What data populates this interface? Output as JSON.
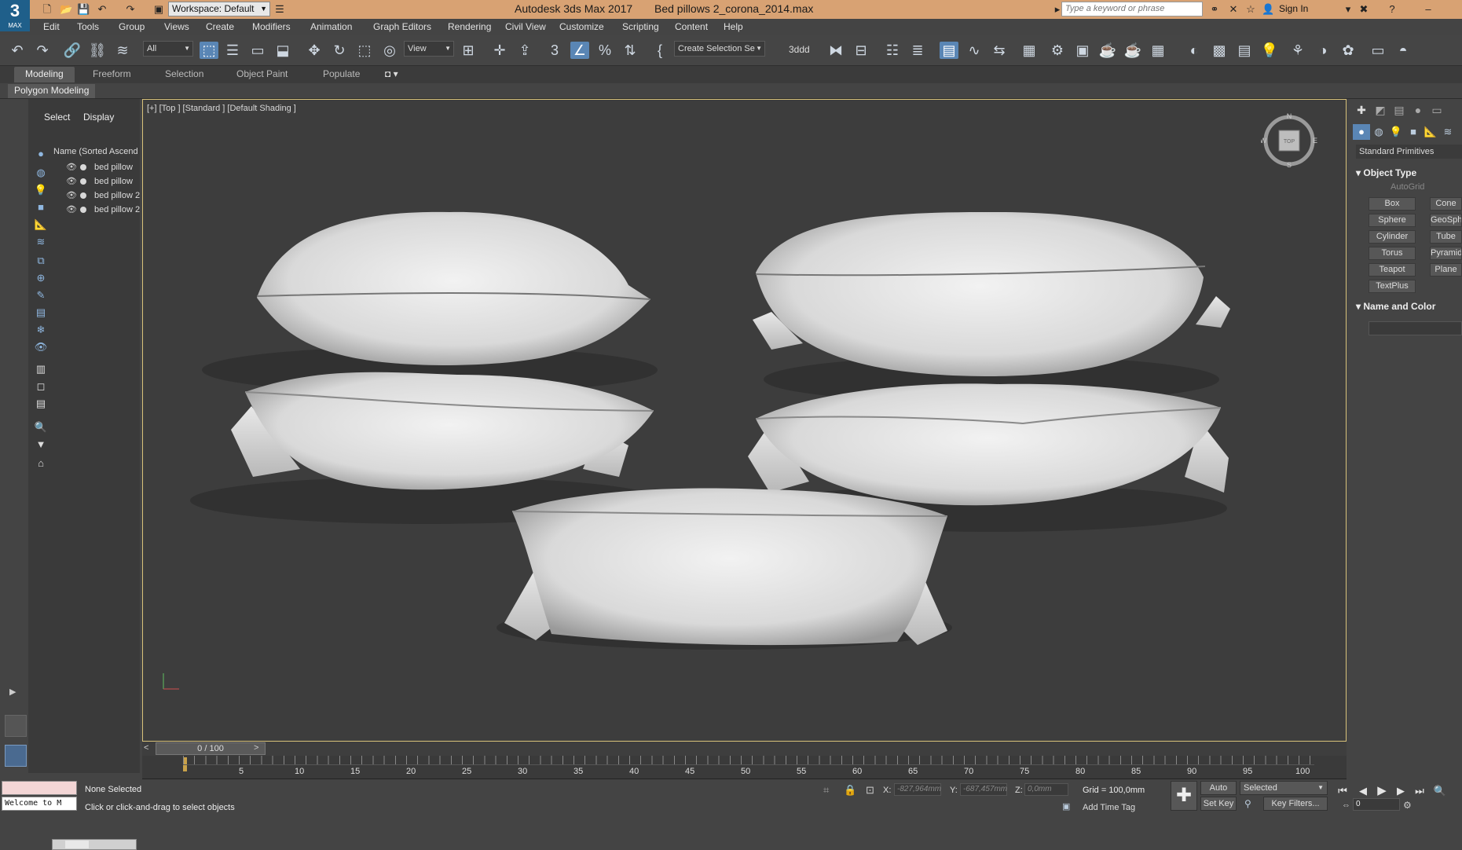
{
  "app": {
    "logo_text": "3",
    "logo_sub": "MAX",
    "title": "Autodesk 3ds Max 2017",
    "file": "Bed pillows 2_corona_2014.max",
    "workspace": "Workspace: Default",
    "search_placeholder": "Type a keyword or phrase",
    "sign_in": "Sign In"
  },
  "menu": [
    "Edit",
    "Tools",
    "Group",
    "Views",
    "Create",
    "Modifiers",
    "Animation",
    "Graph Editors",
    "Rendering",
    "Civil View",
    "Customize",
    "Scripting",
    "Content",
    "Help"
  ],
  "toolbar": {
    "filter": "All",
    "ref_coord": "View",
    "selection_set": "Create Selection Se",
    "label_3ddd": "3ddd"
  },
  "ribbon": {
    "tabs": [
      "Modeling",
      "Freeform",
      "Selection",
      "Object Paint",
      "Populate"
    ],
    "active_tab": "Modeling",
    "panel": "Polygon Modeling"
  },
  "explorer": {
    "tabs": [
      "Select",
      "Display"
    ],
    "header": "Name (Sorted Ascend",
    "rows": [
      "bed pillow",
      "bed pillow",
      "bed pillow 2",
      "bed pillow 2"
    ]
  },
  "viewport": {
    "label": "[+] [Top ] [Standard ] [Default Shading ]",
    "compass": {
      "n": "N",
      "s": "S",
      "e": "E",
      "w": "W",
      "face": "TOP"
    }
  },
  "command_panel": {
    "category": "Standard Primitives",
    "object_type_title": "Object Type",
    "autogrid": "AutoGrid",
    "buttons_left": [
      "Box",
      "Sphere",
      "Cylinder",
      "Torus",
      "Teapot",
      "TextPlus"
    ],
    "buttons_right": [
      "Cone",
      "GeoSphere",
      "Tube",
      "Pyramid",
      "Plane"
    ],
    "name_color_title": "Name and Color"
  },
  "timeline": {
    "position": "0 / 100",
    "ticks": [
      "5",
      "10",
      "15",
      "20",
      "25",
      "30",
      "35",
      "40",
      "45",
      "50",
      "55",
      "60",
      "65",
      "70",
      "75",
      "80",
      "85",
      "90",
      "95",
      "100"
    ]
  },
  "status": {
    "maxscript_text": "Welcome to M",
    "selection": "None Selected",
    "prompt": "Click or click-and-drag to select objects",
    "x_label": "X:",
    "x_value": "-827,964mm",
    "y_label": "Y:",
    "y_value": "-687,457mm",
    "z_label": "Z:",
    "z_value": "0,0mm",
    "grid": "Grid = 100,0mm",
    "add_time_tag": "Add Time Tag",
    "auto_key": "Auto Key",
    "set_key": "Set Key",
    "selected_dd": "Selected",
    "key_filters": "Key Filters...",
    "frame": "0"
  }
}
